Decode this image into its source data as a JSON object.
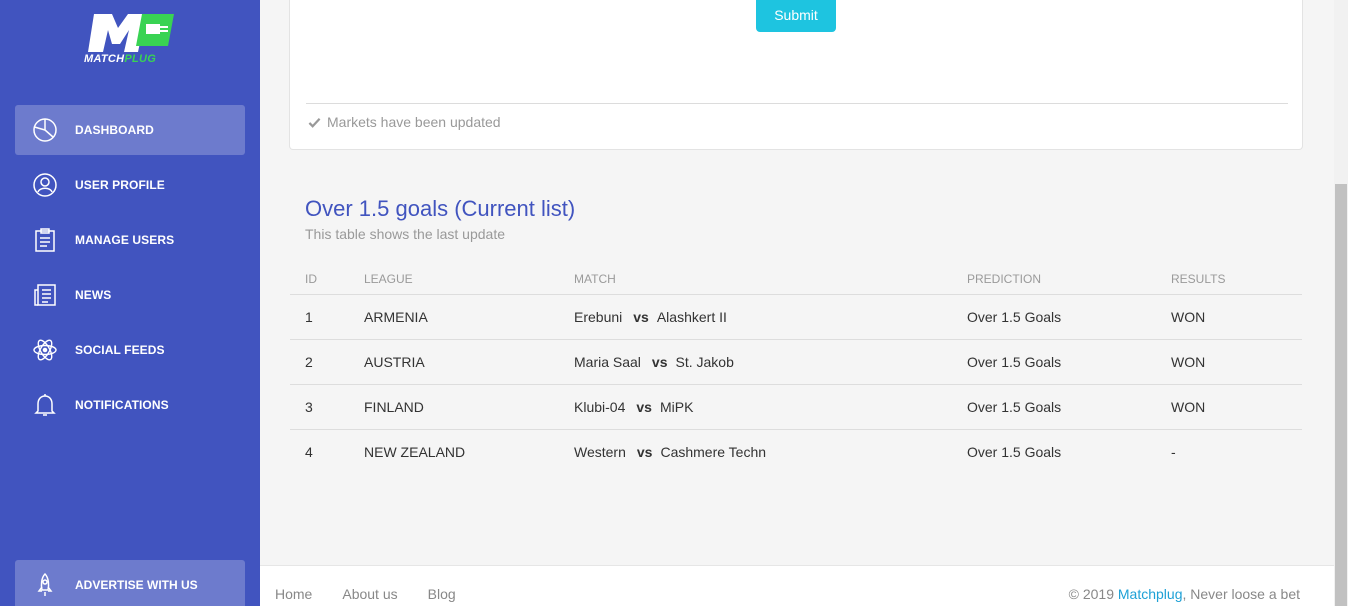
{
  "brand": {
    "logo_letter": "M",
    "name_part1": "MATCH",
    "name_part2": "PLUG",
    "accent_green": "#39d353"
  },
  "sidebar": {
    "items": [
      {
        "label": "DASHBOARD",
        "icon": "pie-chart-icon",
        "active": true
      },
      {
        "label": "USER PROFILE",
        "icon": "user-icon",
        "active": false
      },
      {
        "label": "MANAGE USERS",
        "icon": "clipboard-icon",
        "active": false
      },
      {
        "label": "NEWS",
        "icon": "newspaper-icon",
        "active": false
      },
      {
        "label": "SOCIAL FEEDS",
        "icon": "atom-icon",
        "active": false
      },
      {
        "label": "NOTIFICATIONS",
        "icon": "bell-icon",
        "active": false
      }
    ],
    "bottom_item": {
      "label": "ADVERTISE WITH US",
      "icon": "rocket-icon"
    }
  },
  "card": {
    "submit_label": "Submit",
    "status_text": "Markets have been updated"
  },
  "section": {
    "title": "Over 1.5 goals (Current list)",
    "subtitle": "This table shows the last update"
  },
  "table": {
    "headers": {
      "id": "ID",
      "league": "LEAGUE",
      "match": "MATCH",
      "prediction": "PREDICTION",
      "results": "RESULTS"
    },
    "vs": "vs",
    "rows": [
      {
        "id": "1",
        "league": "ARMENIA",
        "home": "Erebuni",
        "away": "Alashkert II",
        "prediction": "Over 1.5 Goals",
        "result": "WON"
      },
      {
        "id": "2",
        "league": "AUSTRIA",
        "home": "Maria Saal",
        "away": "St. Jakob",
        "prediction": "Over 1.5 Goals",
        "result": "WON"
      },
      {
        "id": "3",
        "league": "FINLAND",
        "home": "Klubi-04",
        "away": "MiPK",
        "prediction": "Over 1.5 Goals",
        "result": "WON"
      },
      {
        "id": "4",
        "league": "NEW ZEALAND",
        "home": "Western",
        "away": "Cashmere Techn",
        "prediction": "Over 1.5 Goals",
        "result": "-"
      }
    ]
  },
  "footer": {
    "links": [
      "Home",
      "About us",
      "Blog"
    ],
    "copyright_prefix": "© 2019 ",
    "copyright_brand": "Matchplug",
    "copyright_suffix": ", Never loose a bet"
  },
  "colors": {
    "sidebar_bg": "#4154bf",
    "accent_cyan": "#1ec4e0",
    "title_blue": "#4154bf",
    "link_blue": "#1ea1d6"
  }
}
